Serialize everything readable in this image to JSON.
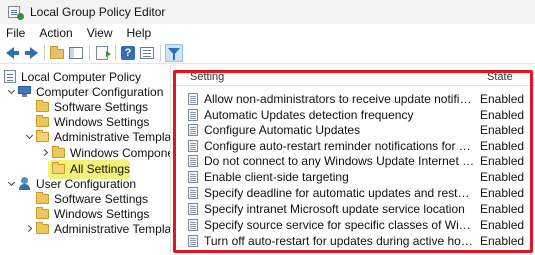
{
  "window": {
    "title": "Local Group Policy Editor"
  },
  "menu": [
    "File",
    "Action",
    "View",
    "Help"
  ],
  "toolbar": {
    "icons": [
      "back-arrow-icon",
      "forward-arrow-icon",
      "up-folder-icon",
      "show-hide-tree-icon",
      "export-list-icon",
      "help-icon",
      "properties-icon",
      "filter-icon"
    ]
  },
  "tree": {
    "root": "Local Computer Policy",
    "computer_config": "Computer Configuration",
    "cc_software": "Software Settings",
    "cc_windows": "Windows Settings",
    "cc_admin": "Administrative Templates",
    "cc_windows_component": "Windows Component",
    "cc_all_settings": "All Settings",
    "user_config": "User Configuration",
    "uc_software": "Software Settings",
    "uc_windows": "Windows Settings",
    "uc_admin": "Administrative Templates"
  },
  "list": {
    "col_setting": "Setting",
    "col_state": "State",
    "rows": [
      {
        "setting": "Allow non-administrators to receive update notifications",
        "state": "Enabled"
      },
      {
        "setting": "Automatic Updates detection frequency",
        "state": "Enabled"
      },
      {
        "setting": "Configure Automatic Updates",
        "state": "Enabled"
      },
      {
        "setting": "Configure auto-restart reminder notifications for updates",
        "state": "Enabled"
      },
      {
        "setting": "Do not connect to any Windows Update Internet locations",
        "state": "Enabled"
      },
      {
        "setting": "Enable client-side targeting",
        "state": "Enabled"
      },
      {
        "setting": "Specify deadline for automatic updates and restarts for quali...",
        "state": "Enabled"
      },
      {
        "setting": "Specify intranet Microsoft update service location",
        "state": "Enabled"
      },
      {
        "setting": "Specify source service for specific classes of Windows Updat...",
        "state": "Enabled"
      },
      {
        "setting": "Turn off auto-restart for updates during active hours",
        "state": "Enabled"
      }
    ]
  },
  "colors": {
    "annotation_red": "#e3161e",
    "highlight_yellow": "#f2f279",
    "accent_blue": "#2f6fb4"
  }
}
